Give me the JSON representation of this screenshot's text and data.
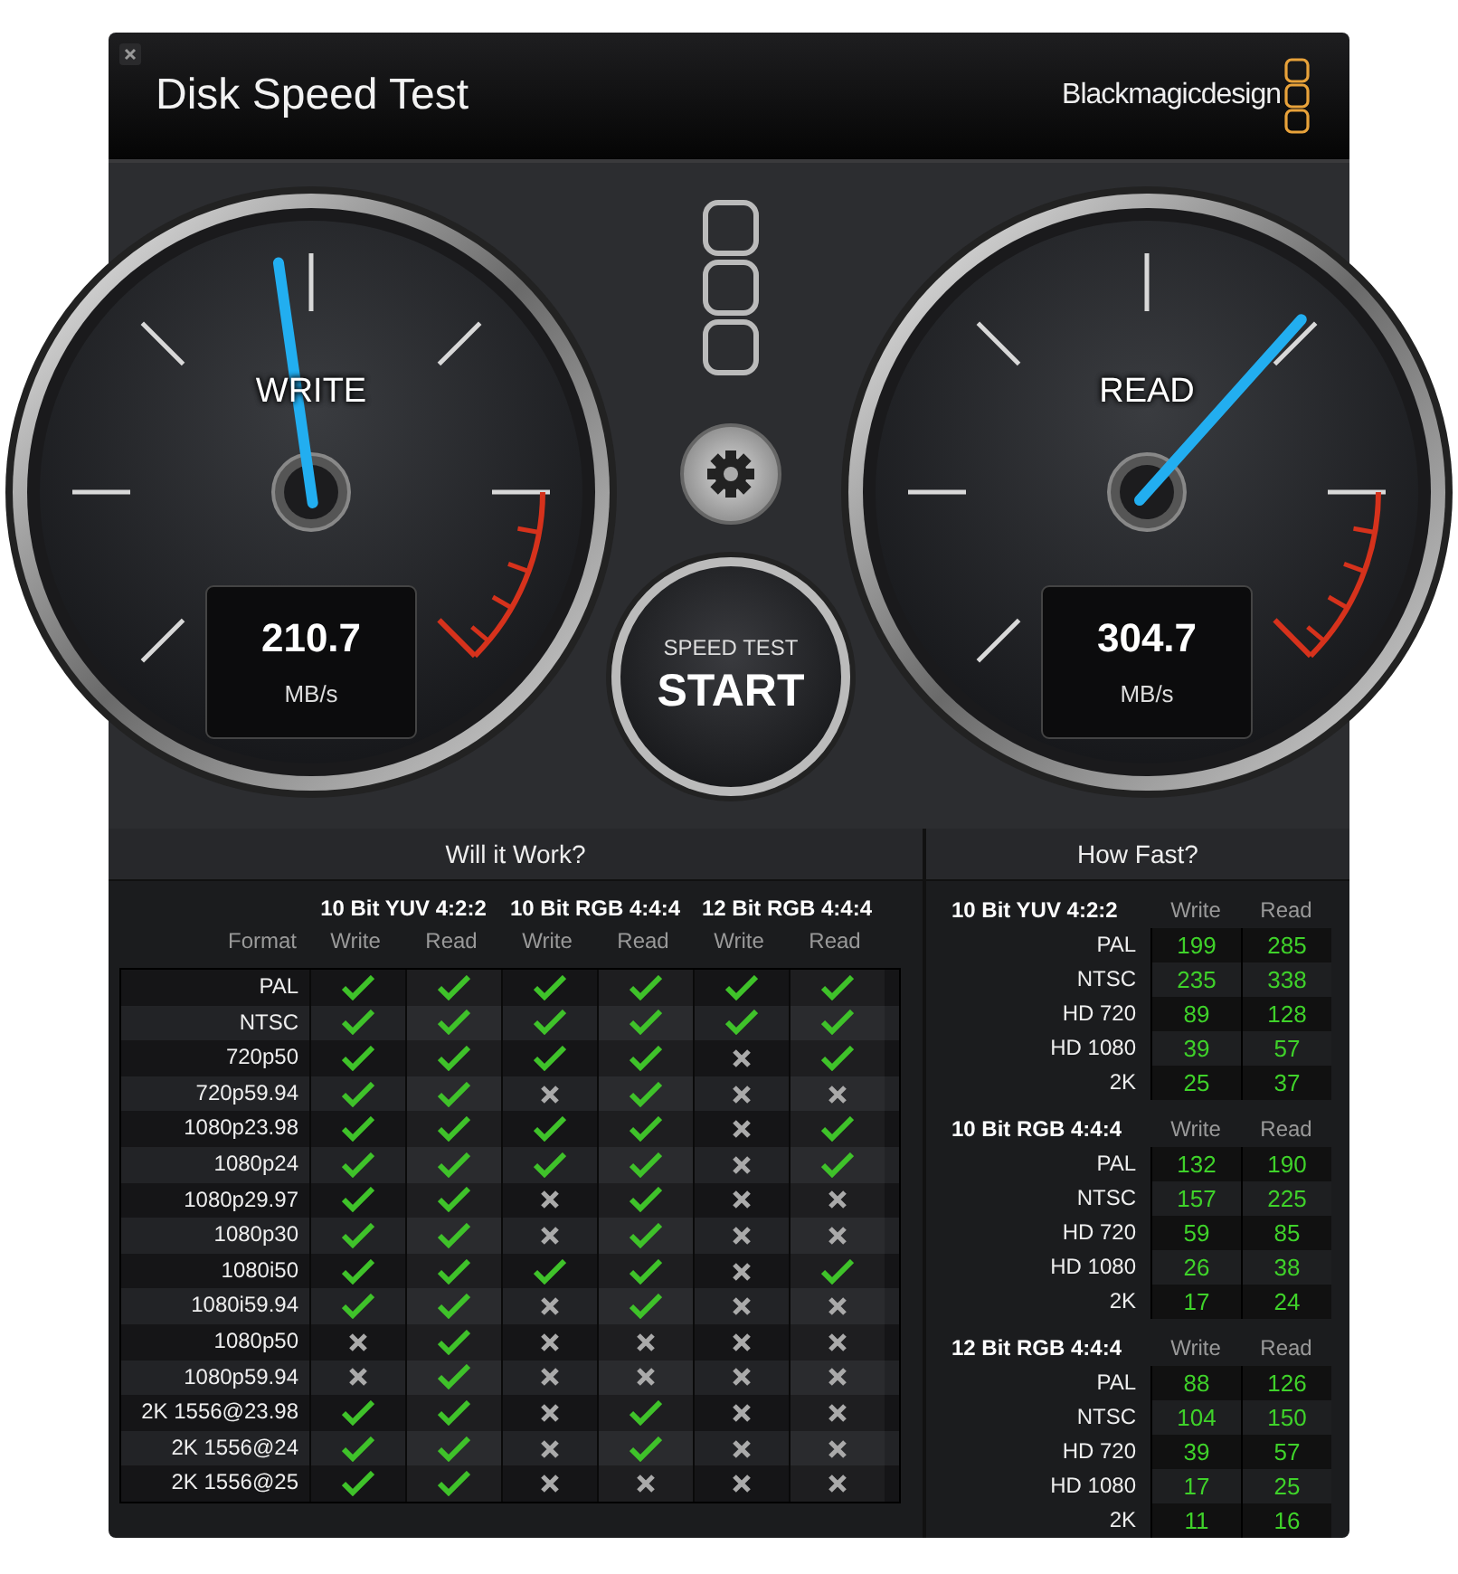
{
  "window": {
    "title": "Disk Speed Test",
    "brand": "Blackmagicdesign"
  },
  "gauges": [
    {
      "label": "WRITE",
      "value": "210.7",
      "unit": "MB/s",
      "level": 0.47
    },
    {
      "label": "READ",
      "value": "304.7",
      "unit": "MB/s",
      "level": 0.655
    }
  ],
  "start_button": {
    "caption": "SPEED TEST",
    "label": "START"
  },
  "will_it_work": {
    "title": "Will it Work?",
    "groups": [
      "10 Bit YUV 4:2:2",
      "10 Bit RGB 4:4:4",
      "12 Bit RGB 4:4:4"
    ],
    "format_header": "Format",
    "columns": [
      "Write",
      "Read",
      "Write",
      "Read",
      "Write",
      "Read"
    ],
    "rows": [
      {
        "format": "PAL",
        "supported": [
          true,
          true,
          true,
          true,
          true,
          true
        ]
      },
      {
        "format": "NTSC",
        "supported": [
          true,
          true,
          true,
          true,
          true,
          true
        ]
      },
      {
        "format": "720p50",
        "supported": [
          true,
          true,
          true,
          true,
          false,
          true
        ]
      },
      {
        "format": "720p59.94",
        "supported": [
          true,
          true,
          false,
          true,
          false,
          false
        ]
      },
      {
        "format": "1080p23.98",
        "supported": [
          true,
          true,
          true,
          true,
          false,
          true
        ]
      },
      {
        "format": "1080p24",
        "supported": [
          true,
          true,
          true,
          true,
          false,
          true
        ]
      },
      {
        "format": "1080p29.97",
        "supported": [
          true,
          true,
          false,
          true,
          false,
          false
        ]
      },
      {
        "format": "1080p30",
        "supported": [
          true,
          true,
          false,
          true,
          false,
          false
        ]
      },
      {
        "format": "1080i50",
        "supported": [
          true,
          true,
          true,
          true,
          false,
          true
        ]
      },
      {
        "format": "1080i59.94",
        "supported": [
          true,
          true,
          false,
          true,
          false,
          false
        ]
      },
      {
        "format": "1080p50",
        "supported": [
          false,
          true,
          false,
          false,
          false,
          false
        ]
      },
      {
        "format": "1080p59.94",
        "supported": [
          false,
          true,
          false,
          false,
          false,
          false
        ]
      },
      {
        "format": "2K 1556@23.98",
        "supported": [
          true,
          true,
          false,
          true,
          false,
          false
        ]
      },
      {
        "format": "2K 1556@24",
        "supported": [
          true,
          true,
          false,
          true,
          false,
          false
        ]
      },
      {
        "format": "2K 1556@25",
        "supported": [
          true,
          true,
          false,
          false,
          false,
          false
        ]
      }
    ]
  },
  "how_fast": {
    "title": "How Fast?",
    "groups": [
      {
        "name": "10 Bit YUV 4:2:2",
        "write_header": "Write",
        "read_header": "Read",
        "rows": [
          {
            "format": "PAL",
            "write": "199",
            "read": "285"
          },
          {
            "format": "NTSC",
            "write": "235",
            "read": "338"
          },
          {
            "format": "HD 720",
            "write": "89",
            "read": "128"
          },
          {
            "format": "HD 1080",
            "write": "39",
            "read": "57"
          },
          {
            "format": "2K",
            "write": "25",
            "read": "37"
          }
        ]
      },
      {
        "name": "10 Bit RGB 4:4:4",
        "write_header": "Write",
        "read_header": "Read",
        "rows": [
          {
            "format": "PAL",
            "write": "132",
            "read": "190"
          },
          {
            "format": "NTSC",
            "write": "157",
            "read": "225"
          },
          {
            "format": "HD 720",
            "write": "59",
            "read": "85"
          },
          {
            "format": "HD 1080",
            "write": "26",
            "read": "38"
          },
          {
            "format": "2K",
            "write": "17",
            "read": "24"
          }
        ]
      },
      {
        "name": "12 Bit RGB 4:4:4",
        "write_header": "Write",
        "read_header": "Read",
        "rows": [
          {
            "format": "PAL",
            "write": "88",
            "read": "126"
          },
          {
            "format": "NTSC",
            "write": "104",
            "read": "150"
          },
          {
            "format": "HD 720",
            "write": "39",
            "read": "57"
          },
          {
            "format": "HD 1080",
            "write": "17",
            "read": "25"
          },
          {
            "format": "2K",
            "write": "11",
            "read": "16"
          }
        ]
      }
    ]
  }
}
